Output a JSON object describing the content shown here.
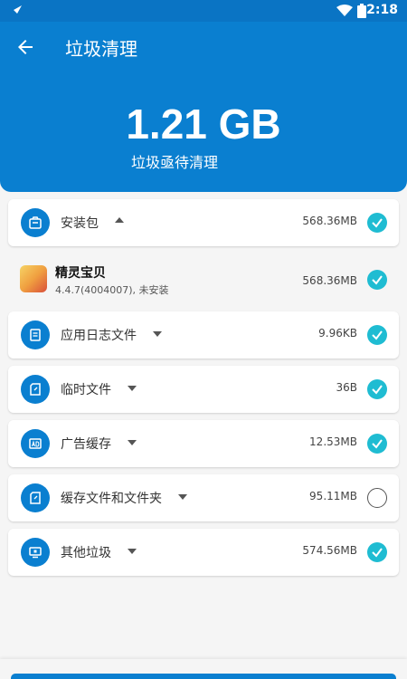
{
  "status_bar": {
    "time": "2:18"
  },
  "app_bar": {
    "title": "垃圾清理"
  },
  "header": {
    "total_size": "1.21 GB",
    "subtitle": "垃圾亟待清理"
  },
  "categories": [
    {
      "label": "安装包",
      "value": "568.36MB",
      "checked": true,
      "expanded": true,
      "icon": "package-icon"
    },
    {
      "label": "应用日志文件",
      "value": "9.96KB",
      "checked": true,
      "expanded": false,
      "icon": "document-icon"
    },
    {
      "label": "临时文件",
      "value": "36B",
      "checked": true,
      "expanded": false,
      "icon": "file-icon"
    },
    {
      "label": "广告缓存",
      "value": "12.53MB",
      "checked": true,
      "expanded": false,
      "icon": "ad-icon"
    },
    {
      "label": "缓存文件和文件夹",
      "value": "95.11MB",
      "checked": false,
      "expanded": false,
      "icon": "file-icon"
    },
    {
      "label": "其他垃圾",
      "value": "574.56MB",
      "checked": true,
      "expanded": false,
      "icon": "monitor-icon"
    }
  ],
  "apk_item": {
    "name": "精灵宝贝",
    "meta": "4.4.7(4004007), 未安装",
    "value": "568.36MB",
    "checked": true
  },
  "colors": {
    "primary": "#0a7fd0",
    "check": "#1fbcd2",
    "background": "#f5f5f5"
  }
}
